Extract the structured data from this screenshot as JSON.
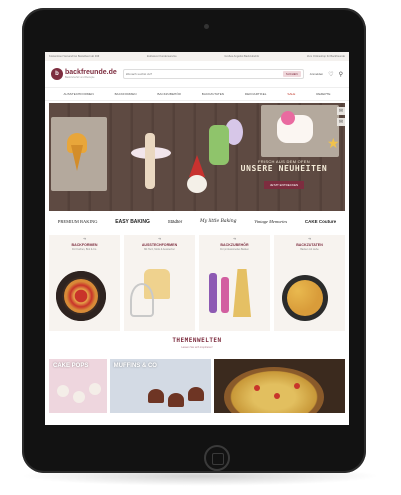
{
  "topbar": {
    "left": "Kostenloser Versand bei Bestellwert ab 49€",
    "middle": "Exklusiver Kundenservice",
    "right_note": "Großes Angebot Backzubehör",
    "right_link": "Zum Onlineshop für Backfreunde"
  },
  "header": {
    "logo_text": "backfreunde.de",
    "logo_sub": "Backzubehör und Rezepte",
    "search_placeholder": "Wonach suchst du?",
    "search_button": "SUCHEN",
    "account_label": "Anmelden",
    "icons": [
      "heart-icon",
      "cart-icon"
    ]
  },
  "nav": {
    "items": [
      "AUSSTECHFORMEN",
      "BACKFORMEN",
      "BACKZUBEHÖR",
      "BACKZUTATEN",
      "DEKOARTIKEL",
      "SALE",
      "REZEPTE"
    ]
  },
  "hero": {
    "subtitle": "FRISCH AUS DEM OFEN",
    "title": "UNSERE NEUHEITEN",
    "button": "JETZT ENTDECKEN"
  },
  "brands": [
    "PREMIUM BAKING",
    "EASY BAKING",
    "Städter",
    "My little Baking",
    "Vintage Memories",
    "CAKE Couture"
  ],
  "categories": [
    {
      "title": "BACKFORMEN",
      "subtitle": "Für Kuchen, Brot & Co."
    },
    {
      "title": "AUSSTECHFORMEN",
      "subtitle": "Mit Herz, Motiv & Ausstecher"
    },
    {
      "title": "BACKZUBEHÖR",
      "subtitle": "Für professionelles Backen"
    },
    {
      "title": "BACKZUTATEN",
      "subtitle": "Backen mit Liebe"
    }
  ],
  "themen": {
    "title": "THEMENWELTEN",
    "link": "Lassen Sie sich inspirieren!"
  },
  "worlds": [
    {
      "label": "CAKE POPS"
    },
    {
      "label": "MUFFINS & CO"
    },
    {
      "label": ""
    }
  ]
}
